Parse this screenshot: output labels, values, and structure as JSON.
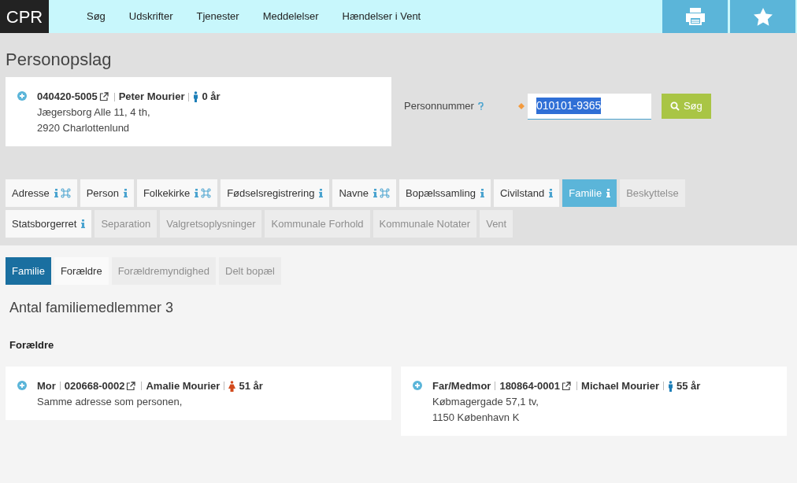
{
  "logo": "CPR",
  "nav": [
    "Søg",
    "Udskrifter",
    "Tjenester",
    "Meddelelser",
    "Hændelser i Vent"
  ],
  "toolbar": [
    {
      "kind": "print"
    },
    {
      "kind": "favorite"
    }
  ],
  "page_title": "Personopslag",
  "person": {
    "cpr": "040420-5005",
    "name": "Peter Mourier",
    "female": false,
    "age": "0 år",
    "address": [
      "Jægersborg Alle 11, 4 th,",
      "2920 Charlottenlund"
    ]
  },
  "search": {
    "label": "Personnummer",
    "required": true,
    "value": "010101-9365",
    "value_selected": true,
    "button": "Søg"
  },
  "tabs": [
    {
      "label": "Adresse",
      "info": true,
      "shortcut": true,
      "disabled": false,
      "selected": false
    },
    {
      "label": "Person",
      "info": true,
      "shortcut": false,
      "disabled": false,
      "selected": false
    },
    {
      "label": "Folkekirke",
      "info": true,
      "shortcut": true,
      "disabled": false,
      "selected": false
    },
    {
      "label": "Fødselsregistrering",
      "info": true,
      "shortcut": false,
      "disabled": false,
      "selected": false
    },
    {
      "label": "Navne",
      "info": true,
      "shortcut": true,
      "disabled": false,
      "selected": false
    },
    {
      "label": "Bopælssamling",
      "info": true,
      "shortcut": false,
      "disabled": false,
      "selected": false
    },
    {
      "label": "Civilstand",
      "info": true,
      "shortcut": false,
      "disabled": false,
      "selected": false
    },
    {
      "label": "Familie",
      "info": true,
      "shortcut": false,
      "disabled": false,
      "selected": true
    },
    {
      "label": "Beskyttelse",
      "info": false,
      "shortcut": false,
      "disabled": true,
      "selected": false
    },
    {
      "label": "Statsborgerret",
      "info": true,
      "shortcut": false,
      "disabled": false,
      "selected": false
    },
    {
      "label": "Separation",
      "info": false,
      "shortcut": false,
      "disabled": true,
      "selected": false
    },
    {
      "label": "Valgretsoplysninger",
      "info": false,
      "shortcut": false,
      "disabled": true,
      "selected": false
    },
    {
      "label": "Kommunale Forhold",
      "info": false,
      "shortcut": false,
      "disabled": true,
      "selected": false
    },
    {
      "label": "Kommunale Notater",
      "info": false,
      "shortcut": false,
      "disabled": true,
      "selected": false
    },
    {
      "label": "Vent",
      "info": false,
      "shortcut": false,
      "disabled": true,
      "selected": false
    }
  ],
  "subtabs": [
    {
      "label": "Familie",
      "disabled": false,
      "selected": true
    },
    {
      "label": "Forældre",
      "disabled": false,
      "selected": false
    },
    {
      "label": "Forældremyndighed",
      "disabled": true,
      "selected": false
    },
    {
      "label": "Delt bopæl",
      "disabled": true,
      "selected": false
    }
  ],
  "family_count": "Antal familiemedlemmer 3",
  "section_heading": "Forældre",
  "parents": [
    {
      "role": "Mor",
      "cpr": "020668-0002",
      "name": "Amalie Mourier",
      "female": true,
      "age": "51 år",
      "address": [
        "Samme adresse som personen,"
      ]
    },
    {
      "role": "Far/Medmor",
      "cpr": "180864-0001",
      "name": "Michael Mourier",
      "female": false,
      "age": "55 år",
      "address": [
        "Købmagergade 57,1 tv,",
        "1150 København K"
      ]
    }
  ]
}
